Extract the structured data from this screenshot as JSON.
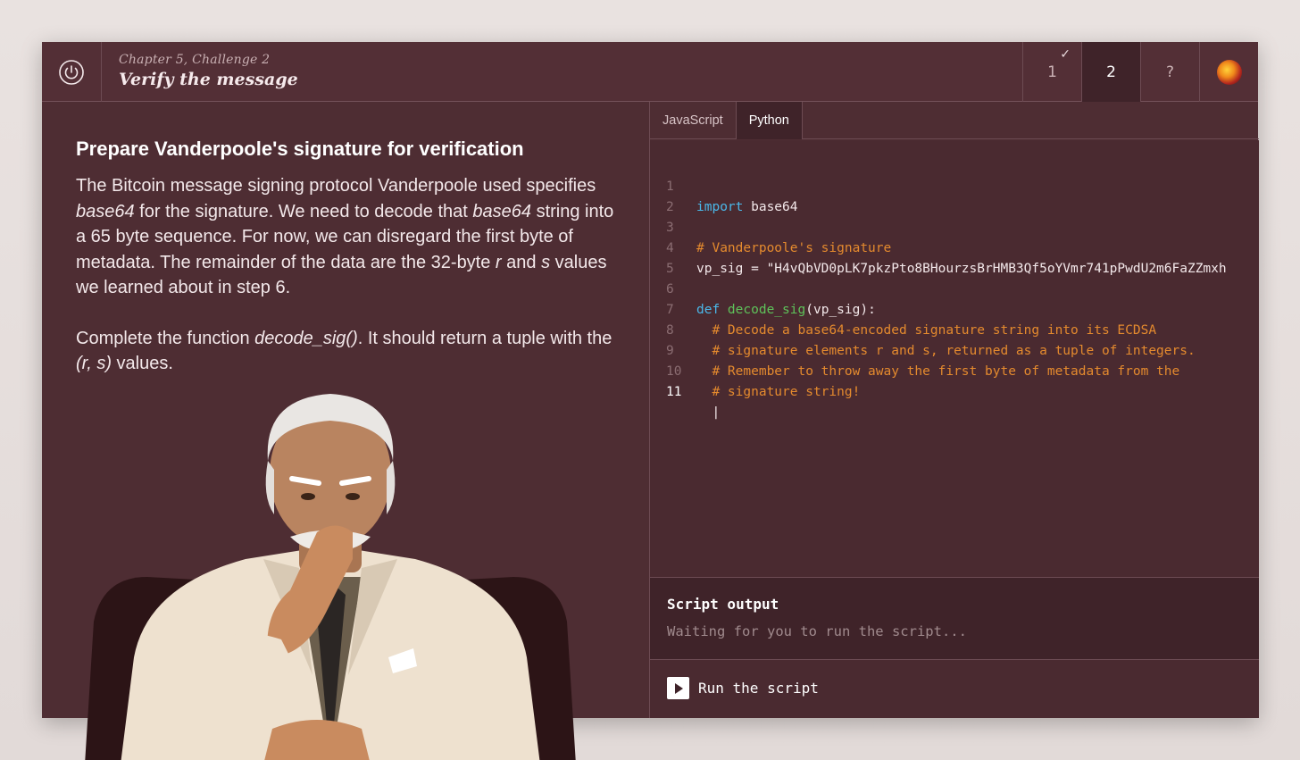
{
  "header": {
    "chapter": "Chapter 5, Challenge 2",
    "title": "Verify the message",
    "steps": [
      {
        "label": "1",
        "completed": true
      },
      {
        "label": "2",
        "active": true
      },
      {
        "label": "?"
      }
    ],
    "icons": {
      "power": "power-icon",
      "check": "✓",
      "avatar": "avatar"
    }
  },
  "prompt": {
    "heading": "Prepare Vanderpoole's signature for verification",
    "p1": {
      "t1": "The Bitcoin message signing protocol Vanderpoole used specifies ",
      "e1": "base64",
      "t2": " for the signature. We need to decode that ",
      "e2": "base64",
      "t3": " string into a 65 byte sequence. For now, we can disregard the first byte of metadata. The remainder of the data are the 32-byte ",
      "e3": "r",
      "t4": " and ",
      "e4": "s",
      "t5": " values we learned about in step 6."
    },
    "p2": {
      "t1": "Complete the function ",
      "e1": "decode_sig()",
      "t2": ". It should return a tuple with the ",
      "e2": "(r, s)",
      "t3": " values."
    }
  },
  "editor": {
    "tabs": [
      "JavaScript",
      "Python"
    ],
    "active_tab": "Python",
    "lines": [
      {
        "n": "1",
        "a": "import",
        "b": " base64"
      },
      {
        "n": "2"
      },
      {
        "n": "3",
        "c": "# Vanderpoole's signature"
      },
      {
        "n": "4",
        "b": "vp_sig = \"H4vQbVD0pLK7pkzPto8BHourzsBrHMB3Qf5oYVmr741pPwdU2m6FaZZmxh"
      },
      {
        "n": "5"
      },
      {
        "n": "6",
        "a": "def",
        "f": " decode_sig",
        "b": "(vp_sig):"
      },
      {
        "n": "7",
        "c": "  # Decode a base64-encoded signature string into its ECDSA"
      },
      {
        "n": "8",
        "c": "  # signature elements r and s, returned as a tuple of integers."
      },
      {
        "n": "9",
        "c": "  # Remember to throw away the first byte of metadata from the"
      },
      {
        "n": "10",
        "c": "  # signature string!"
      },
      {
        "n": "11",
        "b": "  |"
      }
    ],
    "current_line": "11"
  },
  "output": {
    "title": "Script output",
    "text": "Waiting for you to run the script..."
  },
  "run": {
    "label": "Run the script"
  },
  "colors": {
    "bg": "#4e2d33",
    "header": "#532f36",
    "active_tab": "#3f2329",
    "keyword": "#4ab7e8",
    "function": "#5ec25a",
    "comment": "#e48a2e"
  }
}
